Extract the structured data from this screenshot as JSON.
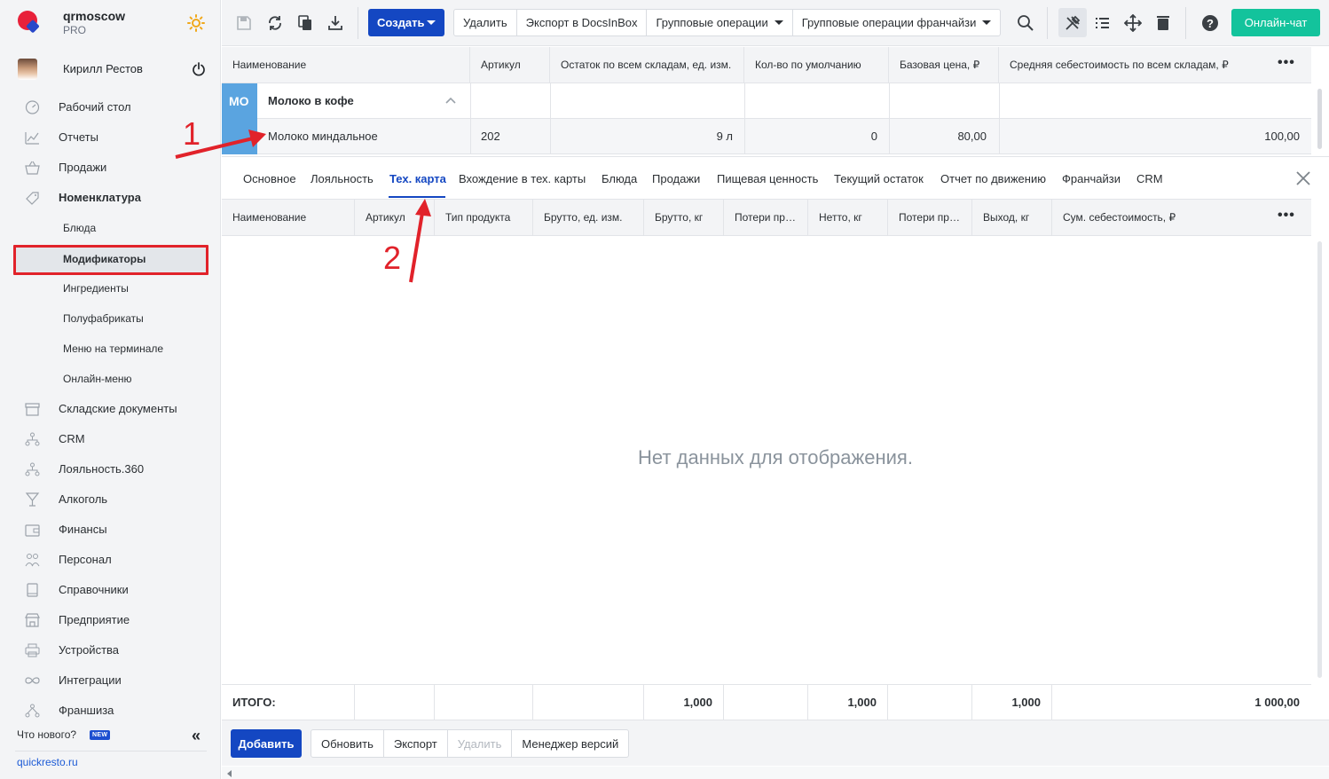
{
  "brand": {
    "name": "qrmoscow",
    "plan": "PRO"
  },
  "user": {
    "name": "Кирилл Рестов"
  },
  "sidebar": {
    "items": [
      {
        "label": "Рабочий стол",
        "icon": "gauge-icon"
      },
      {
        "label": "Отчеты",
        "icon": "chart-icon"
      },
      {
        "label": "Продажи",
        "icon": "basket-icon"
      },
      {
        "label": "Номенклатура",
        "icon": "tag-icon"
      }
    ],
    "sub_items": [
      "Блюда",
      "Модификаторы",
      "Ингредиенты",
      "Полуфабрикаты",
      "Меню на терминале",
      "Онлайн-меню"
    ],
    "items_after": [
      {
        "label": "Складские документы",
        "icon": "archive-icon"
      },
      {
        "label": "CRM",
        "icon": "network-icon"
      },
      {
        "label": "Лояльность.360",
        "icon": "network2-icon"
      },
      {
        "label": "Алкоголь",
        "icon": "glass-icon"
      },
      {
        "label": "Финансы",
        "icon": "wallet-icon"
      },
      {
        "label": "Персонал",
        "icon": "people-icon"
      },
      {
        "label": "Справочники",
        "icon": "book-icon"
      },
      {
        "label": "Предприятие",
        "icon": "store-icon"
      },
      {
        "label": "Устройства",
        "icon": "printer-icon"
      },
      {
        "label": "Интеграции",
        "icon": "infinity-icon"
      },
      {
        "label": "Франшиза",
        "icon": "franchise-icon"
      }
    ],
    "whats_new": "Что нового?",
    "new_badge": "NEW",
    "site": "quickresto.ru"
  },
  "toolbar": {
    "create_label": "Создать",
    "actions": [
      "Удалить",
      "Экспорт в DocsInBox",
      "Групповые операции",
      "Групповые операции франчайзи"
    ],
    "chat_label": "Онлайн-чат"
  },
  "grid": {
    "headers": [
      "Наименование",
      "Артикул",
      "Остаток по всем складам, ед. изм.",
      "Кол-во по умолчанию",
      "Базовая цена, ₽",
      "Средняя себестоимость по всем складам, ₽"
    ],
    "group": {
      "badge": "МО",
      "name": "Молоко в кофе"
    },
    "row": {
      "name": "Молоко миндальное",
      "article": "202",
      "stock": "9 л",
      "default_qty": "0",
      "base_price": "80,00",
      "avg_cost": "100,00"
    }
  },
  "tabs": [
    "Основное",
    "Лояльность",
    "Тех. карта",
    "Вхождение в тех. карты",
    "Блюда",
    "Продажи",
    "Пищевая ценность",
    "Текущий остаток",
    "Отчет по движению",
    "Франчайзи",
    "CRM"
  ],
  "detail": {
    "headers": [
      "Наименование",
      "Артикул",
      "Тип продукта",
      "Брутто, ед. изм.",
      "Брутто, кг",
      "Потери при...",
      "Нетто, кг",
      "Потери при...",
      "Выход, кг",
      "Сум. себестоимость, ₽"
    ],
    "empty": "Нет данных для отображения.",
    "totals": {
      "label": "ИТОГО:",
      "brutto_kg": "1,000",
      "netto_kg": "1,000",
      "output_kg": "1,000",
      "sum_cost": "1 000,00"
    }
  },
  "bottom": {
    "add_label": "Добавить",
    "buttons": [
      "Обновить",
      "Экспорт",
      "Удалить",
      "Менеджер версий"
    ]
  },
  "annotations": {
    "one": "1",
    "two": "2"
  },
  "colors": {
    "accent": "#1447c2",
    "chat": "#13c39c",
    "annotation": "#e1222a",
    "badge": "#5aa4e0"
  }
}
